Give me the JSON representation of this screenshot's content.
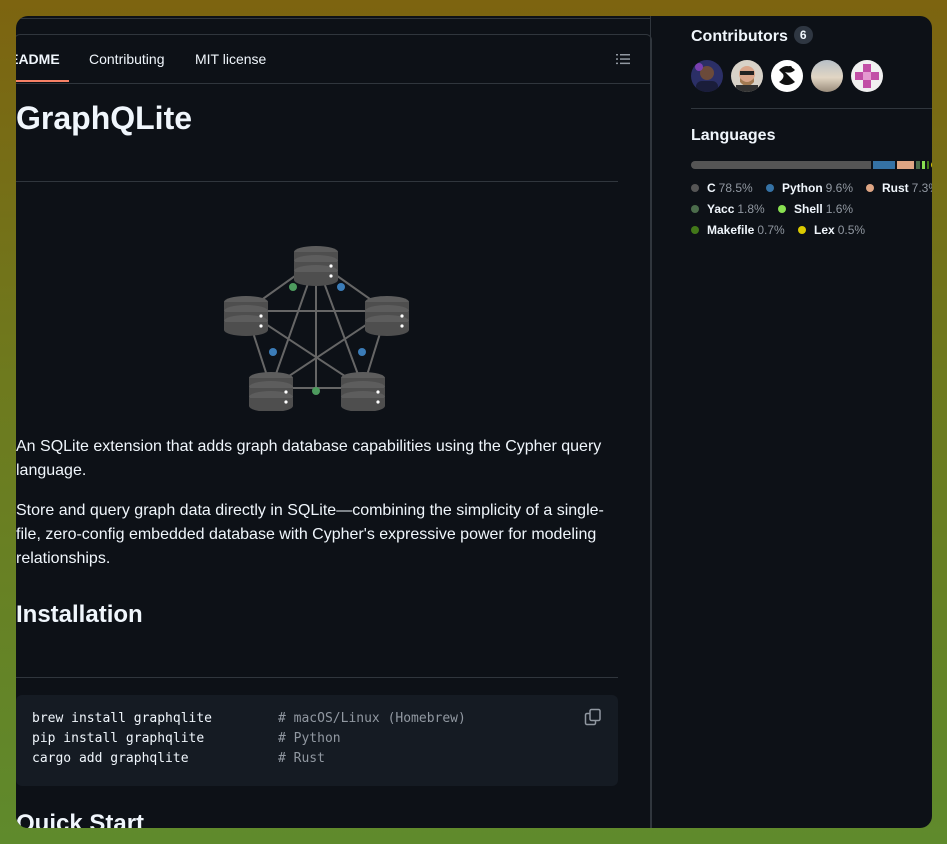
{
  "tabs": [
    {
      "label": "README",
      "active": true
    },
    {
      "label": "Contributing",
      "active": false
    },
    {
      "label": "MIT license",
      "active": false
    }
  ],
  "readme": {
    "title": "GraphQLite",
    "description_1": "An SQLite extension that adds graph database capabilities using the Cypher query language.",
    "description_2": "Store and query graph data directly in SQLite—combining the simplicity of a single-file, zero-config embedded database with Cypher's expressive power for modeling relationships.",
    "installation_heading": "Installation",
    "code": [
      {
        "cmd": "brew install graphqlite",
        "comment": "# macOS/Linux (Homebrew)"
      },
      {
        "cmd": "pip install graphqlite",
        "comment": "# Python"
      },
      {
        "cmd": "cargo add graphqlite",
        "comment": "# Rust"
      }
    ],
    "quickstart_heading": "Quick Start"
  },
  "sidebar": {
    "contributors_label": "Contributors",
    "contributors_count": "6",
    "languages_label": "Languages",
    "languages": [
      {
        "name": "C",
        "percent": "78.5%",
        "value": 78.5,
        "color": "#555555"
      },
      {
        "name": "Python",
        "percent": "9.6%",
        "value": 9.6,
        "color": "#3572A5"
      },
      {
        "name": "Rust",
        "percent": "7.3%",
        "value": 7.3,
        "color": "#dea584"
      },
      {
        "name": "Yacc",
        "percent": "1.8%",
        "value": 1.8,
        "color": "#4B6C4B"
      },
      {
        "name": "Shell",
        "percent": "1.6%",
        "value": 1.6,
        "color": "#89e051"
      },
      {
        "name": "Makefile",
        "percent": "0.7%",
        "value": 0.7,
        "color": "#427819"
      },
      {
        "name": "Lex",
        "percent": "0.5%",
        "value": 0.5,
        "color": "#DBCA00"
      }
    ]
  }
}
